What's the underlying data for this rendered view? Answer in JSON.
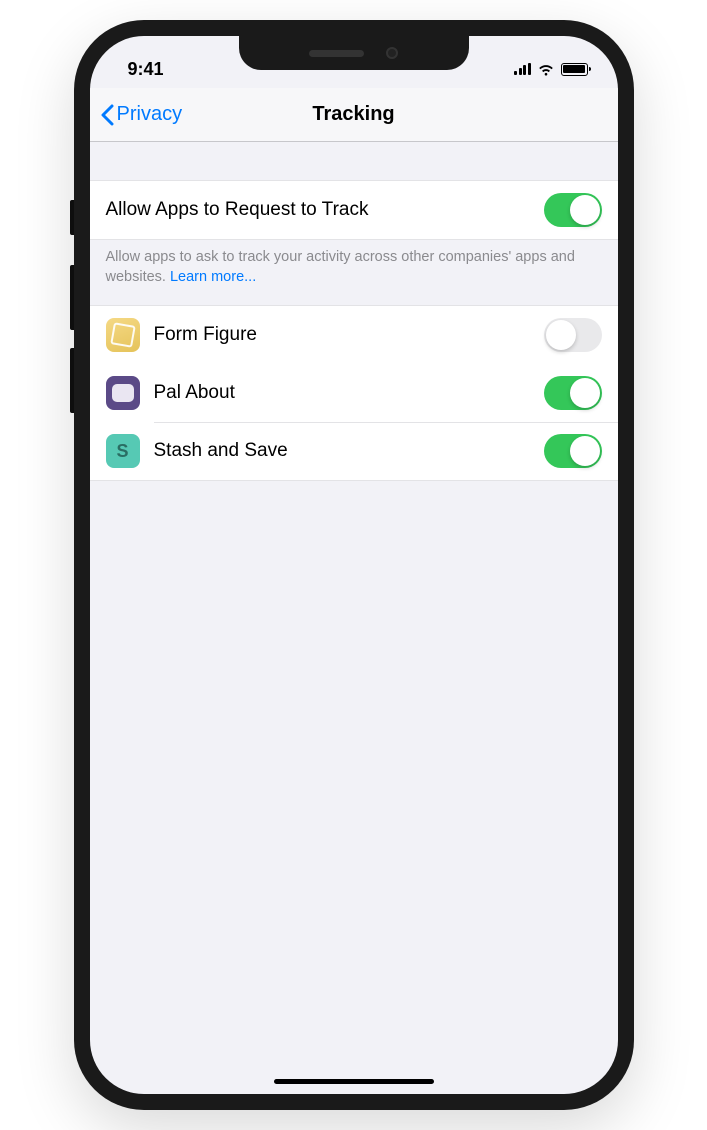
{
  "status": {
    "time": "9:41"
  },
  "nav": {
    "back_label": "Privacy",
    "title": "Tracking"
  },
  "main_toggle": {
    "label": "Allow Apps to Request to Track",
    "on": true
  },
  "footer": {
    "text": "Allow apps to ask to track your activity across other companies' apps and websites. ",
    "link": "Learn more..."
  },
  "apps": [
    {
      "name": "Form Figure",
      "on": false,
      "icon": "cube",
      "color": "yellow"
    },
    {
      "name": "Pal About",
      "on": true,
      "icon": "bubble",
      "color": "purple"
    },
    {
      "name": "Stash and Save",
      "on": true,
      "icon": "letter-s",
      "color": "teal"
    }
  ]
}
